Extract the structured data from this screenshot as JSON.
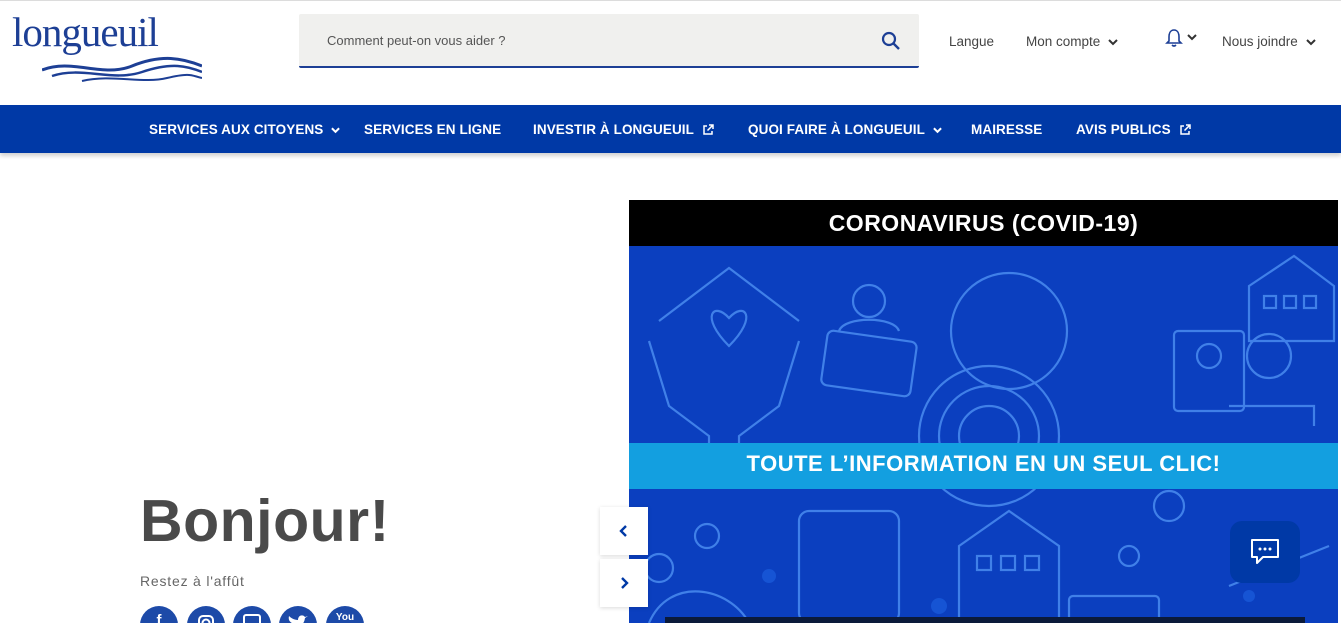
{
  "logo": {
    "text": "longueuil"
  },
  "search": {
    "placeholder": "Comment peut-on vous aider ?",
    "icon": "search-icon"
  },
  "utility": {
    "language": "Langue",
    "account": "Mon compte",
    "notifications_icon": "bell-icon",
    "contact": "Nous joindre"
  },
  "nav": {
    "items": [
      {
        "label": "SERVICES AUX CITOYENS",
        "icon": "chevron-down-icon"
      },
      {
        "label": "SERVICES EN LIGNE"
      },
      {
        "label": "INVESTIR À LONGUEUIL",
        "icon": "external-link-icon"
      },
      {
        "label": "QUOI FAIRE À LONGUEUIL",
        "icon": "chevron-down-icon"
      },
      {
        "label": "MAIRESSE"
      },
      {
        "label": "AVIS PUBLICS",
        "icon": "external-link-icon"
      }
    ]
  },
  "hero": {
    "greeting": "Bonjour!",
    "tagline": "Restez à l'affût",
    "social": [
      "facebook-icon",
      "instagram-icon",
      "linkedin-icon",
      "twitter-icon",
      "youtube-icon"
    ],
    "youtube_text": "You"
  },
  "banner": {
    "title": "CORONAVIRUS (COVID-19)",
    "subtitle": "TOUTE L’INFORMATION EN UN SEUL CLIC!"
  },
  "carousel": {
    "prev_icon": "chevron-left-icon",
    "next_icon": "chevron-right-icon"
  },
  "chat": {
    "icon": "chat-icon"
  },
  "colors": {
    "brand": "#0039a6",
    "logo": "#1d3f95",
    "stripe": "#139fe0",
    "banner": "#0b3fbf"
  }
}
